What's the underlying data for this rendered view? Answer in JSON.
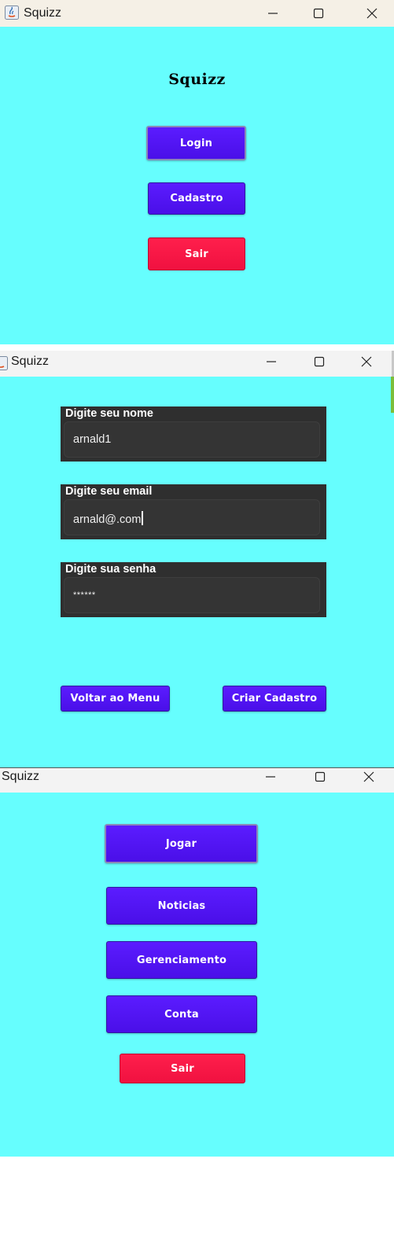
{
  "window1": {
    "title": "Squizz",
    "heading": "Squizz",
    "buttons": {
      "login": "Login",
      "signup": "Cadastro",
      "exit": "Sair"
    }
  },
  "window2": {
    "title": "Squizz",
    "fields": {
      "name_label": "Digite seu nome",
      "name_value": "arnald1",
      "email_label": "Digite seu email",
      "email_value": "arnald@.com",
      "password_label": "Digite sua senha",
      "password_value": "******"
    },
    "buttons": {
      "back": "Voltar ao Menu",
      "create": "Criar Cadastro"
    }
  },
  "window3": {
    "title": "Squizz",
    "buttons": {
      "play": "Jogar",
      "news": "Noticias",
      "management": "Gerenciamento",
      "account": "Conta",
      "exit": "Sair"
    }
  },
  "theme": {
    "background": "#66fefe",
    "button_purple": "#4f12f2",
    "button_red": "#ff1a48",
    "field_bg": "#2f2f2f"
  }
}
